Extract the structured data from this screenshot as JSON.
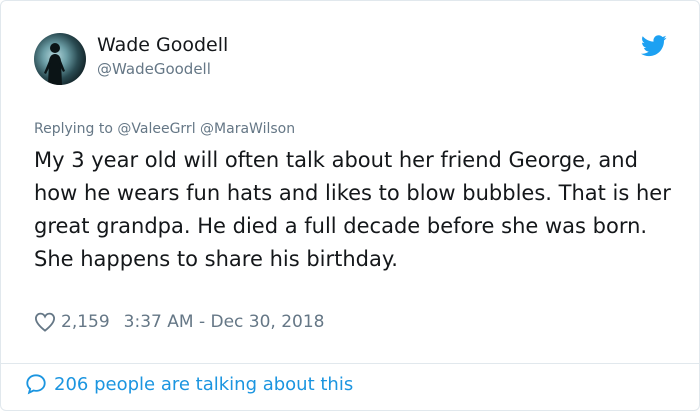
{
  "author": {
    "name": "Wade Goodell",
    "handle": "@WadeGoodell"
  },
  "replying": {
    "prefix": "Replying to",
    "mentions": [
      "@ValeeGrrl",
      "@MaraWilson"
    ]
  },
  "tweet": {
    "text": "My 3 year old will often talk about her friend George, and how he wears fun hats and likes to blow bubbles. That is her great grandpa. He died a full decade before she was born. She happens to share his birthday."
  },
  "meta": {
    "likes": "2,159",
    "time": "3:37 AM - Dec 30, 2018"
  },
  "footer": {
    "label": "206 people are talking about this"
  },
  "colors": {
    "twitter_blue": "#1da1f2",
    "link_blue": "#1b95e0",
    "secondary_text": "#657786",
    "border": "#e1e8ed"
  },
  "icons": {
    "brand": "twitter-bird-icon",
    "like": "heart-icon",
    "reply": "speech-bubble-icon"
  }
}
